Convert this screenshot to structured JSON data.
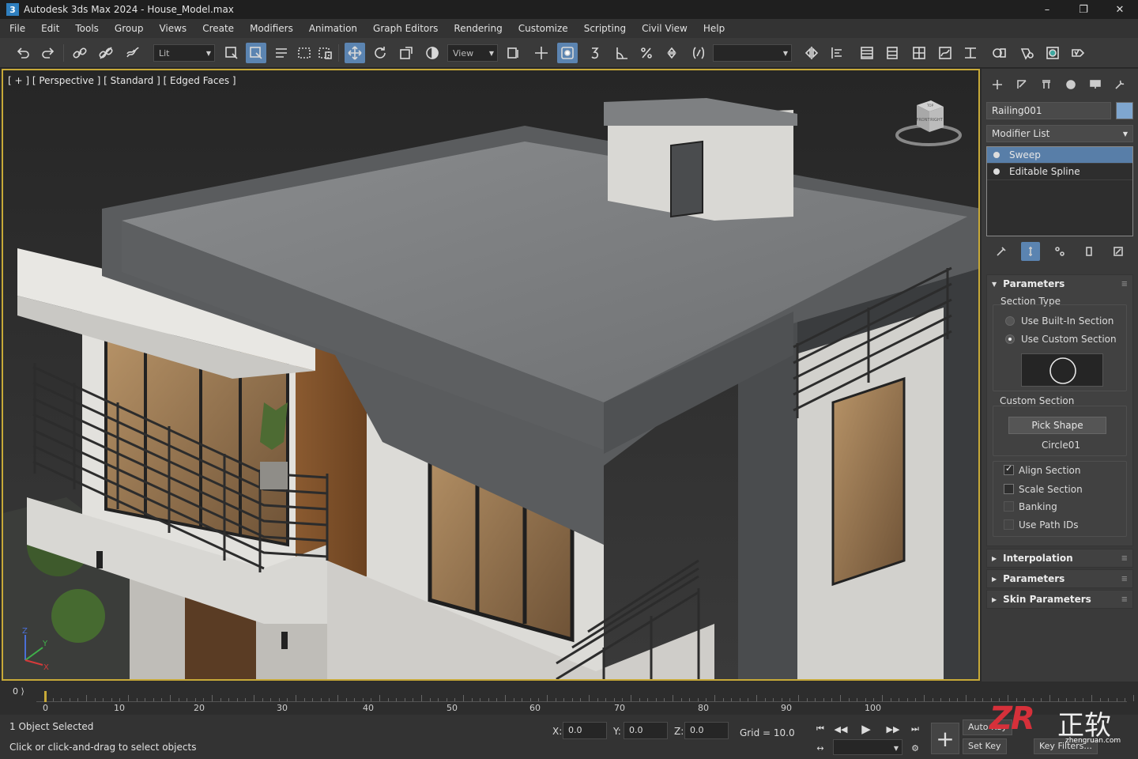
{
  "window": {
    "app_icon": "3",
    "title": "Autodesk 3ds Max 2024 - House_Model.max",
    "controls": [
      "minimize-icon",
      "restore-icon",
      "close-icon"
    ],
    "control_glyphs": [
      "–",
      "❐",
      "✕"
    ]
  },
  "menu": [
    "File",
    "Edit",
    "Tools",
    "Group",
    "Views",
    "Create",
    "Modifiers",
    "Animation",
    "Graph Editors",
    "Rendering",
    "Customize",
    "Scripting",
    "Civil View",
    "Help"
  ],
  "toolbar": {
    "icons": [
      "undo-icon",
      "redo-icon",
      "link-icon",
      "unlink-icon",
      "bind-space-warp-icon",
      "select-filter-icon",
      "select-object-icon",
      "select-by-name-icon",
      "rect-selection-icon",
      "window-crossing-icon",
      "move-icon",
      "rotate-icon",
      "scale-icon",
      "placement-icon",
      "angle-snap-icon",
      "percent-snap-icon",
      "spinner-snap-icon",
      "mirror-icon",
      "align-icon",
      "render-icon"
    ],
    "selection_filter": "Lit",
    "reference_coord": "View",
    "named_selection": ""
  },
  "viewport": {
    "label": "[ + ] [ Perspective ]  [ Standard ] [ Edged Faces ]",
    "viewcube_faces": [
      "TOP",
      "FRONT",
      "RIGHT"
    ],
    "axes": [
      "Z",
      "Y",
      "X"
    ]
  },
  "command_panel": {
    "tabs": [
      "create-icon",
      "modify-icon",
      "hierarchy-icon",
      "motion-icon",
      "display-icon",
      "utilities-icon"
    ],
    "object_name": "Railing001",
    "object_color": "#7fa6cf",
    "modifier_list": "Modifier List",
    "stack": [
      {
        "label": "Sweep",
        "selected": true
      },
      {
        "label": "Editable Spline",
        "selected": false
      }
    ],
    "rollouts": {
      "parameters": {
        "title": "Parameters",
        "section_type": "Section Type",
        "use_builtin": "Use Built-In Section",
        "use_custom": "Use Custom Section",
        "custom_section": "Custom Section",
        "pick_shape": "Pick Shape",
        "shape_name": "Circle01",
        "align_section": "Align Section",
        "scale_section": "Scale Section",
        "banking": "Banking",
        "use_path_ids": "Use Path IDs",
        "checked": {
          "align_section": true,
          "scale_section": false,
          "banking": false,
          "use_path_ids": false
        }
      },
      "interpolation": "Interpolation",
      "parameters2": "Parameters",
      "skin_parameters": "Skin Parameters"
    }
  },
  "timeline": {
    "frame_indicator": "0",
    "current_frame": 0,
    "labels": [
      "0",
      "10",
      "20",
      "30",
      "40",
      "50",
      "60",
      "70",
      "80",
      "90",
      "100"
    ]
  },
  "status": {
    "selection": "1 Object Selected",
    "prompt": "Click or click-and-drag to select objects",
    "x_label": "X:",
    "x_value": "0.0",
    "y_label": "Y:",
    "y_value": "0.0",
    "z_label": "Z:",
    "z_value": "0.0",
    "grid": "Grid = 10.0",
    "auto_key": "Auto Key",
    "set_key": "Set Key",
    "key_filters": "Key Filters..."
  },
  "watermark": {
    "logo": "ZR",
    "chinese": "正软",
    "url": "zhengruan.com"
  },
  "colors": {
    "accent": "#5b84b1",
    "viewport_border": "#c7a938",
    "panel_bg": "#3a3a3a"
  }
}
